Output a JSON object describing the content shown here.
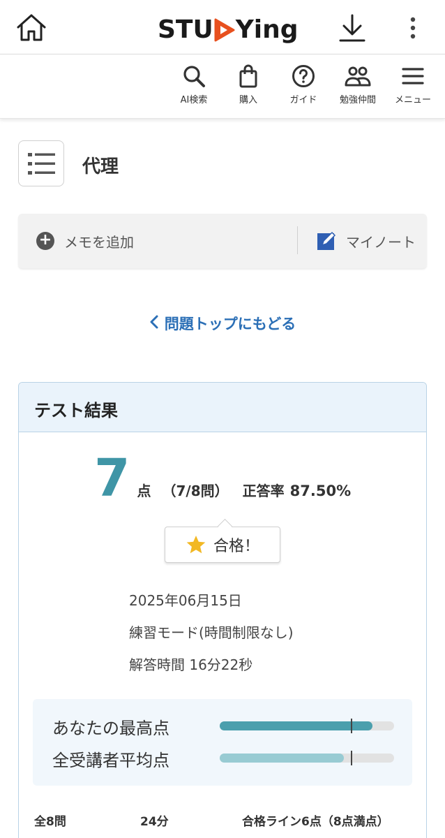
{
  "header": {
    "logo_text_left": "STU",
    "logo_text_right": "Ying",
    "home_icon": "home-icon",
    "download_icon": "download-icon",
    "more_icon": "more-vertical-icon",
    "brand_color": "#e8501e"
  },
  "subnav": {
    "items": [
      {
        "label": "AI検索",
        "icon": "search-icon"
      },
      {
        "label": "購入",
        "icon": "shopping-bag-icon"
      },
      {
        "label": "ガイド",
        "icon": "help-circle-icon"
      },
      {
        "label": "勉強仲間",
        "icon": "people-icon"
      },
      {
        "label": "メニュー",
        "icon": "hamburger-menu-icon"
      }
    ]
  },
  "lesson": {
    "title": "代理",
    "list_icon": "list-icon"
  },
  "memo": {
    "add_label": "メモを追加",
    "mynote_label": "マイノート"
  },
  "back_link": {
    "label": "問題トップにもどる"
  },
  "result": {
    "header": "テスト結果",
    "score": "7",
    "score_unit": "点",
    "detail": "（7/8問）",
    "rate_label": "正答率",
    "rate_value": "87.50%",
    "pass_label": "合格！",
    "date": "2025年06月15日",
    "mode": "練習モード(時間制限なし)",
    "time": "解答時間 16分22秒",
    "comparison": {
      "best_label": "あなたの最高点",
      "best_fraction": 0.875,
      "average_label": "全受講者平均点",
      "average_fraction": 0.71,
      "pass_line_fraction": 0.75,
      "best_color": "#4b9fad",
      "average_color": "#98cbd3"
    },
    "summary": {
      "questions": "全8問",
      "minutes": "24分",
      "pass_line": "合格ライン6点（8点満点）"
    }
  }
}
